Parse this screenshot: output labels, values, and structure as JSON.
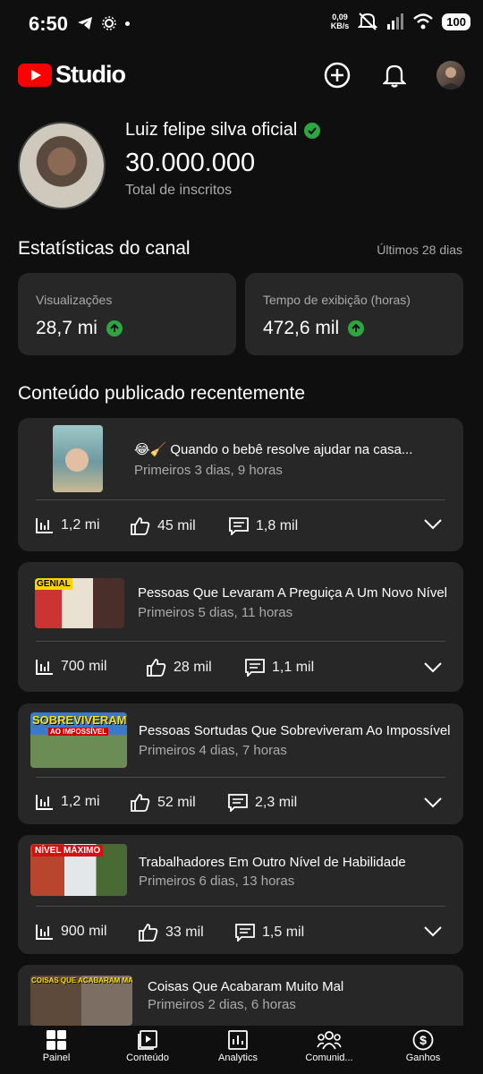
{
  "status_bar": {
    "time": "6:50",
    "net_speed_value": "0,09",
    "net_speed_unit": "KB/s",
    "battery": "100"
  },
  "header": {
    "logo_text": "Studio",
    "brand_color": "#ff0000"
  },
  "channel": {
    "name": "Luiz felipe silva oficial",
    "subscribers": "30.000.000",
    "subscribers_label": "Total de inscritos"
  },
  "stats": {
    "title": "Estatísticas do canal",
    "period": "Últimos 28 dias",
    "views_label": "Visualizações",
    "views_value": "28,7 mi",
    "watch_label": "Tempo de exibição (horas)",
    "watch_value": "472,6 mil"
  },
  "recent": {
    "title": "Conteúdo publicado recentemente",
    "videos": [
      {
        "title": "😂🧹 Quando o bebê resolve ajudar na casa...",
        "period": "Primeiros 3 dias, 9 horas",
        "views": "1,2 mi",
        "likes": "45 mil",
        "comments": "1,8 mil"
      },
      {
        "title": "Pessoas Que Levaram A Preguiça A Um Novo Nível",
        "period": "Primeiros 5 dias, 11 horas",
        "views": "700 mil",
        "likes": "28 mil",
        "comments": "1,1 mil",
        "thumb_text": "GENIAL"
      },
      {
        "title": "Pessoas Sortudas Que Sobreviveram Ao Impossível",
        "period": "Primeiros 4 dias, 7 horas",
        "views": "1,2 mi",
        "likes": "52 mil",
        "comments": "2,3 mil",
        "thumb_text": "SOBREVIVERAM",
        "thumb_text2": "AO IMPOSSÍVEL"
      },
      {
        "title": "Trabalhadores Em Outro Nível de Habilidade",
        "period": "Primeiros 6 dias, 13 horas",
        "views": "900 mil",
        "likes": "33 mil",
        "comments": "1,5 mil",
        "thumb_text": "NÍVEL MÁXIMO"
      },
      {
        "title": "Coisas Que Acabaram Muito Mal",
        "period": "Primeiros 2 dias, 6 horas",
        "thumb_text": "COISAS QUE ACABARAM MAL"
      }
    ]
  },
  "nav": {
    "items": [
      {
        "label": "Painel",
        "icon": "dashboard-icon"
      },
      {
        "label": "Conteúdo",
        "icon": "content-icon"
      },
      {
        "label": "Analytics",
        "icon": "analytics-icon"
      },
      {
        "label": "Comunid...",
        "icon": "community-icon"
      },
      {
        "label": "Ganhos",
        "icon": "earnings-icon"
      }
    ]
  }
}
